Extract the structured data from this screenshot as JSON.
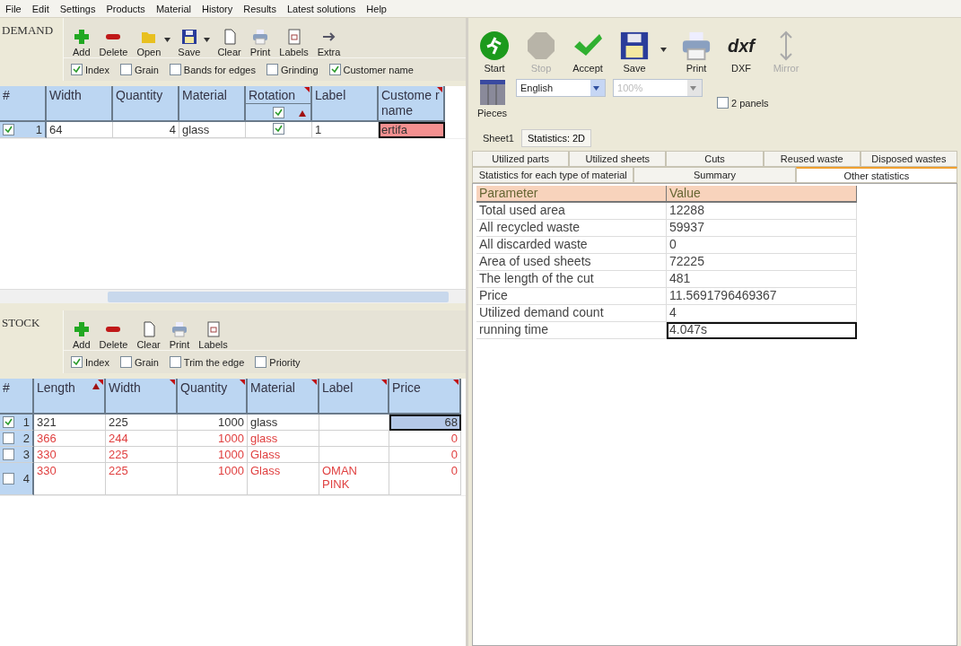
{
  "menu": [
    "File",
    "Edit",
    "Settings",
    "Products",
    "Material",
    "History",
    "Results",
    "Latest solutions",
    "Help"
  ],
  "demand": {
    "title": "DEMAND",
    "toolbar": [
      {
        "kind": "add",
        "label": "Add",
        "dropdown": false
      },
      {
        "kind": "delete",
        "label": "Delete",
        "dropdown": false
      },
      {
        "kind": "open",
        "label": "Open",
        "dropdown": true
      },
      {
        "kind": "save",
        "label": "Save",
        "dropdown": true
      },
      {
        "kind": "clear",
        "label": "Clear",
        "dropdown": false
      },
      {
        "kind": "print",
        "label": "Print",
        "dropdown": false
      },
      {
        "kind": "labels",
        "label": "Labels",
        "dropdown": false
      },
      {
        "kind": "extra",
        "label": "Extra",
        "dropdown": false
      }
    ],
    "options": [
      {
        "label": "Index",
        "checked": true
      },
      {
        "label": "Grain",
        "checked": false
      },
      {
        "label": "Bands for edges",
        "checked": false
      },
      {
        "label": "Grinding",
        "checked": false
      },
      {
        "label": "Customer name",
        "checked": true
      }
    ],
    "columns": [
      {
        "label": "#",
        "kind": "index",
        "filter_mark": false
      },
      {
        "label": "Width",
        "kind": "text",
        "filter_mark": false
      },
      {
        "label": "Quantity",
        "kind": "number",
        "filter_mark": false
      },
      {
        "label": "Material",
        "kind": "text",
        "filter_mark": false
      },
      {
        "label": "Rotation",
        "kind": "check",
        "filter_mark": true,
        "sub_checked": true,
        "sorted": true
      },
      {
        "label": "Label",
        "kind": "text",
        "filter_mark": false
      },
      {
        "label": "Custome r name",
        "kind": "text",
        "filter_mark": true
      }
    ],
    "rows": [
      {
        "checked": true,
        "used": true,
        "cells": [
          {
            "text": "1"
          },
          {
            "text": "64",
            "selected": false
          },
          {
            "text": "4",
            "selected": false
          },
          {
            "text": "glass",
            "selected": false
          },
          {
            "checked": true
          },
          {
            "text": "1",
            "selected": false
          },
          {
            "text": "ertifa",
            "selected": true
          }
        ]
      }
    ]
  },
  "stock": {
    "title": "STOCK",
    "toolbar": [
      {
        "kind": "add",
        "label": "Add",
        "dropdown": false
      },
      {
        "kind": "delete",
        "label": "Delete",
        "dropdown": false
      },
      {
        "kind": "clear",
        "label": "Clear",
        "dropdown": false
      },
      {
        "kind": "print",
        "label": "Print",
        "dropdown": false
      },
      {
        "kind": "labels",
        "label": "Labels",
        "dropdown": false
      }
    ],
    "options": [
      {
        "label": "Index",
        "checked": true
      },
      {
        "label": "Grain",
        "checked": false
      },
      {
        "label": "Trim the edge",
        "checked": false
      },
      {
        "label": "Priority",
        "checked": false
      }
    ],
    "columns": [
      {
        "label": "#",
        "kind": "index",
        "filter_mark": false
      },
      {
        "label": "Length",
        "kind": "text",
        "filter_mark": true,
        "sorted": true
      },
      {
        "label": "Width",
        "kind": "text",
        "filter_mark": true
      },
      {
        "label": "Quantity",
        "kind": "number",
        "filter_mark": true
      },
      {
        "label": "Material",
        "kind": "text",
        "filter_mark": true
      },
      {
        "label": "Label",
        "kind": "text",
        "filter_mark": true
      },
      {
        "label": "Price",
        "kind": "number",
        "filter_mark": true
      }
    ],
    "rows": [
      {
        "checked": true,
        "used": true,
        "cells": [
          {
            "text": "1"
          },
          {
            "text": "321",
            "selected": false
          },
          {
            "text": "225",
            "selected": false
          },
          {
            "text": "1000",
            "selected": false
          },
          {
            "text": "glass",
            "selected": false
          },
          {
            "text": "",
            "selected": false
          },
          {
            "text": "68",
            "selected": true
          }
        ]
      },
      {
        "checked": false,
        "used": false,
        "cells": [
          {
            "text": "2"
          },
          {
            "text": "366",
            "selected": false
          },
          {
            "text": "244",
            "selected": false
          },
          {
            "text": "1000",
            "selected": false
          },
          {
            "text": "glass",
            "selected": false
          },
          {
            "text": "",
            "selected": false
          },
          {
            "text": "0",
            "selected": false
          }
        ]
      },
      {
        "checked": false,
        "used": false,
        "cells": [
          {
            "text": "3"
          },
          {
            "text": "330",
            "selected": false
          },
          {
            "text": "225",
            "selected": false
          },
          {
            "text": "1000",
            "selected": false
          },
          {
            "text": "Glass",
            "selected": false
          },
          {
            "text": "",
            "selected": false
          },
          {
            "text": "0",
            "selected": false
          }
        ]
      },
      {
        "checked": false,
        "used": false,
        "cells": [
          {
            "text": "4"
          },
          {
            "text": "330",
            "selected": false
          },
          {
            "text": "225",
            "selected": false
          },
          {
            "text": "1000",
            "selected": false
          },
          {
            "text": "Glass",
            "selected": false
          },
          {
            "text": "OMAN PINK",
            "selected": false
          },
          {
            "text": "0",
            "selected": false
          }
        ]
      }
    ]
  },
  "solver": {
    "toolbar": [
      {
        "kind": "start",
        "label": "Start",
        "disabled": false,
        "dropdown": false
      },
      {
        "kind": "stop",
        "label": "Stop",
        "disabled": true,
        "dropdown": false
      },
      {
        "kind": "accept",
        "label": "Accept",
        "disabled": false,
        "dropdown": false
      },
      {
        "kind": "save",
        "label": "Save",
        "disabled": false,
        "dropdown": true
      },
      {
        "kind": "print",
        "label": "Print",
        "disabled": false,
        "dropdown": false
      },
      {
        "kind": "dxf",
        "label": "DXF",
        "icon_text": "dxf",
        "disabled": false,
        "dropdown": false
      },
      {
        "kind": "mirror",
        "label": "Mirror",
        "disabled": true,
        "dropdown": false
      }
    ],
    "pieces_label": "Pieces",
    "language": {
      "value": "English",
      "disabled": false
    },
    "zoom": {
      "value": "100%",
      "disabled": true
    },
    "two_panels": {
      "label": "2 panels",
      "checked": false
    },
    "sheet_label": "Sheet1",
    "view_tab": "Statistics: 2D",
    "tab_rows": [
      [
        {
          "label": "Utilized parts",
          "selected": false
        },
        {
          "label": "Utilized sheets",
          "selected": false
        },
        {
          "label": "Cuts",
          "selected": false
        },
        {
          "label": "Reused waste",
          "selected": false
        },
        {
          "label": "Disposed wastes",
          "selected": false
        }
      ],
      [
        {
          "label": "Statistics for each type of material",
          "selected": false
        },
        {
          "label": "Summary",
          "selected": false
        },
        {
          "label": "Other statistics",
          "selected": true
        }
      ]
    ],
    "stats": {
      "columns": [
        "Parameter",
        "Value"
      ],
      "rows": [
        {
          "parameter": "Total used area",
          "value": "12288",
          "selected": false
        },
        {
          "parameter": "All recycled waste",
          "value": "59937",
          "selected": false
        },
        {
          "parameter": "All discarded waste",
          "value": "0",
          "selected": false
        },
        {
          "parameter": "Area of used sheets",
          "value": "72225",
          "selected": false
        },
        {
          "parameter": "The length of the cut",
          "value": "481",
          "selected": false
        },
        {
          "parameter": "Price",
          "value": "11.5691796469367",
          "selected": false
        },
        {
          "parameter": "Utilized demand count",
          "value": "4",
          "selected": false
        },
        {
          "parameter": "running time",
          "value": "4.047s",
          "selected": true
        }
      ]
    }
  }
}
